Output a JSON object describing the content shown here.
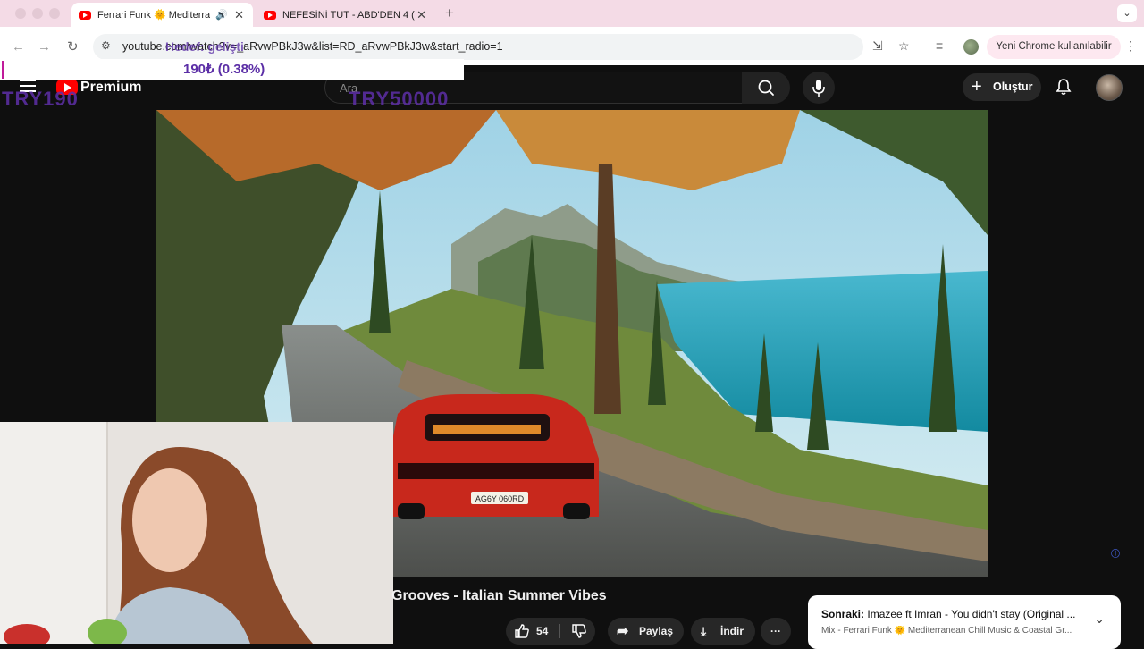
{
  "browser": {
    "tabs": [
      {
        "title": "Ferrari Funk 🌞 Mediterra",
        "active": true,
        "audio": true
      },
      {
        "title": "NEFESİNİ TUT - ABD'DEN 4 (",
        "active": false
      }
    ],
    "new_tab_label": "+",
    "tab_menu_label": "⌄",
    "url": "youtube.com/watch?v=_aRvwPBkJ3w&list=RD_aRvwPBkJ3w&start_radio=1",
    "update_chip": "Yeni Chrome kullanılabilir",
    "icons": [
      "back-icon",
      "forward-icon",
      "reload-icon",
      "site-info-icon",
      "install-icon",
      "star-icon",
      "reading-list-icon",
      "profile-icon",
      "kebab-icon"
    ]
  },
  "overlay": {
    "goal_label": "Hedef: gelişti",
    "amount": "190₺ (0.38%)",
    "try_current": "TRY190",
    "try_goal": "TRY50000"
  },
  "youtube": {
    "brand": "Premium",
    "search_placeholder": "Ara",
    "create_label": "Oluştur",
    "colors": {
      "brand_red": "#ff0000",
      "background": "#0f0f0f"
    }
  },
  "video": {
    "title_visible": "Grooves - Italian Summer Vibes",
    "plate": "AG6Y 060RD",
    "actions": [
      {
        "name": "like",
        "label": "54"
      },
      {
        "name": "dislike",
        "label": ""
      },
      {
        "name": "share",
        "label": "Paylaş"
      },
      {
        "name": "download",
        "label": "İndir"
      },
      {
        "name": "more",
        "label": "···"
      }
    ]
  },
  "next_up": {
    "prefix": "Sonraki:",
    "title": "Imazee ft Imran - You didn't stay (Original ...",
    "mix_line": "Mix - Ferrari Funk 🌞 Mediterranean Chill Music & Coastal Gr..."
  }
}
